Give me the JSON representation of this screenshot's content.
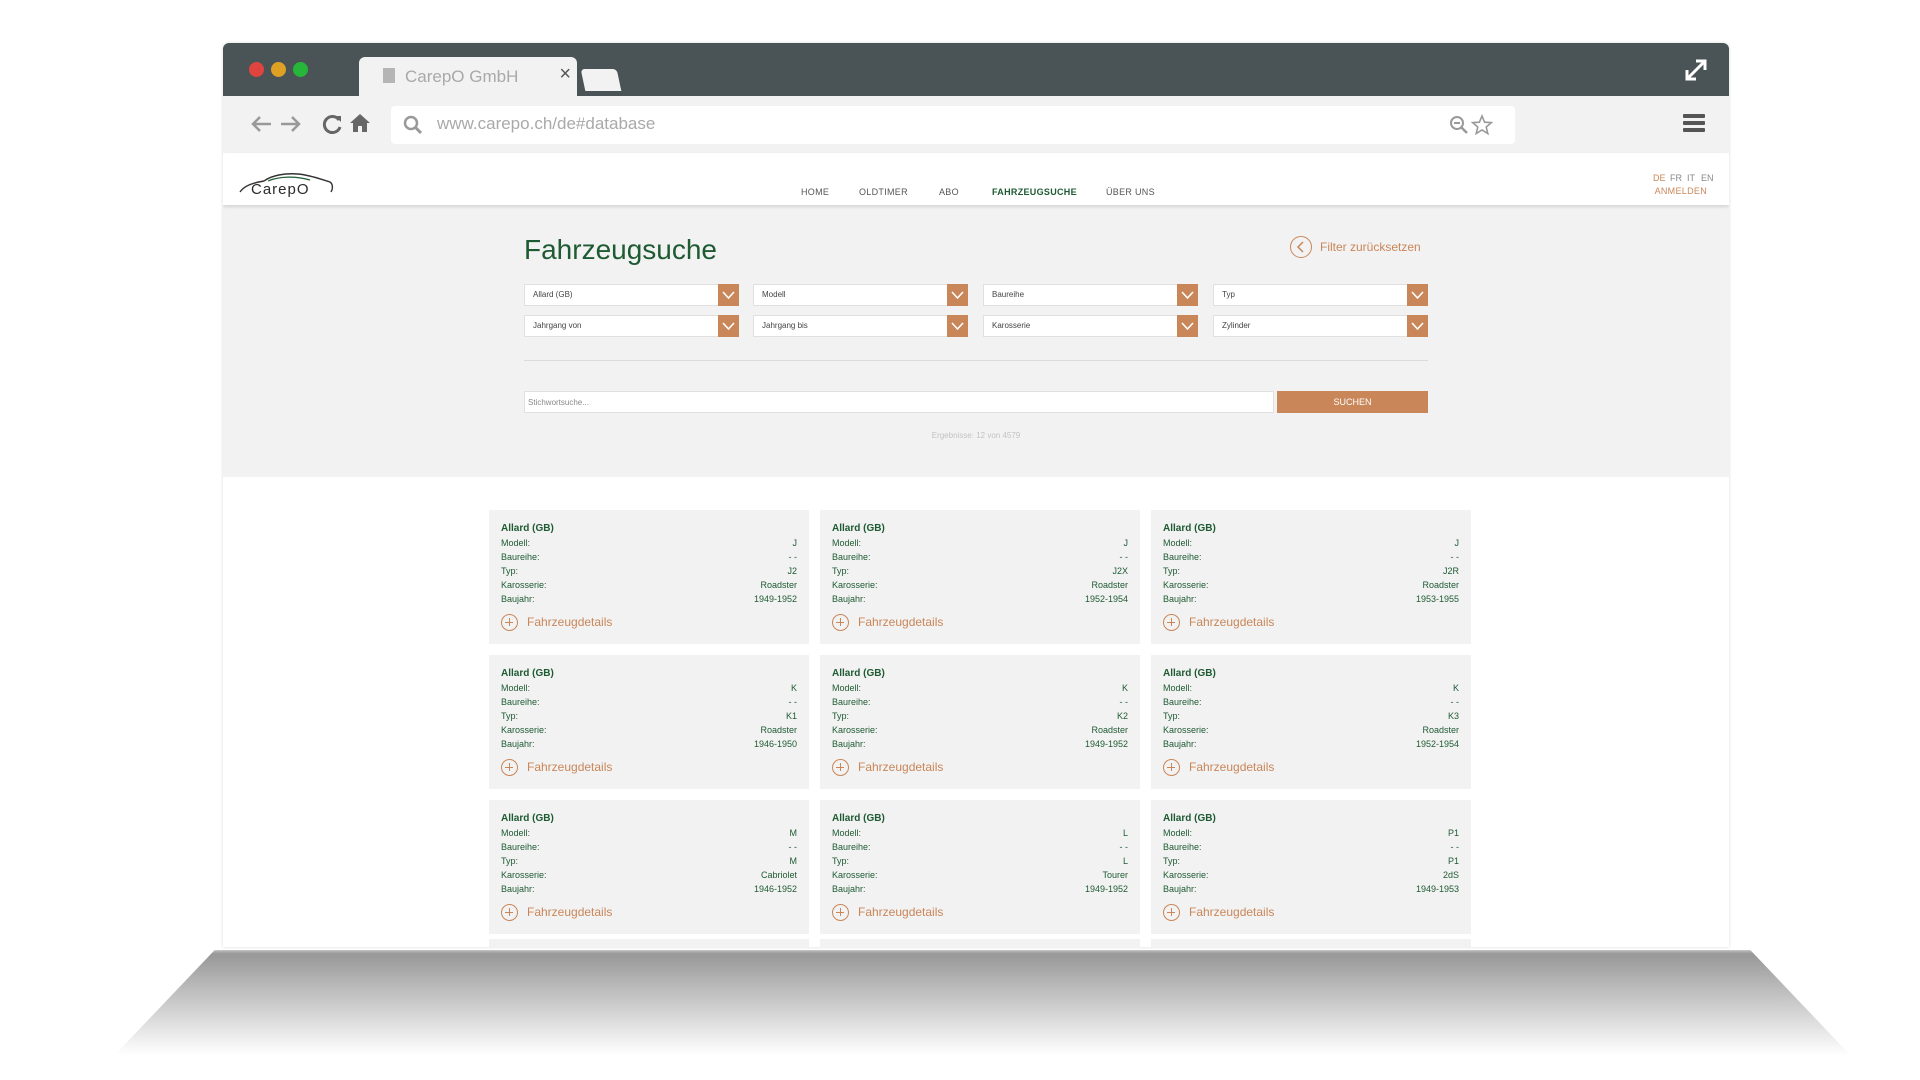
{
  "browser": {
    "tab_title": "CarepO GmbH",
    "tab_close": "×",
    "url": "www.carepo.ch/de#database",
    "icons": [
      "back-arrow-icon",
      "forward-arrow-icon",
      "reload-icon",
      "home-icon",
      "search-icon",
      "zoom-icon",
      "star-icon",
      "menu-icon",
      "expand-icon"
    ]
  },
  "site": {
    "logo_text": "CarepO",
    "nav": [
      "HOME",
      "OLDTIMER",
      "ABO",
      "FAHRZEUGSUCHE",
      "ÜBER UNS"
    ],
    "active_nav": "FAHRZEUGSUCHE",
    "languages": [
      "DE",
      "FR",
      "IT",
      "EN"
    ],
    "active_language": "DE",
    "login": "ANMELDEN"
  },
  "search": {
    "title": "Fahrzeugsuche",
    "reset_label": "Filter zurücksetzen",
    "filters_row1": [
      "Allard (GB)",
      "Modell",
      "Baureihe",
      "Typ"
    ],
    "filters_row2": [
      "Jahrgang von",
      "Jahrgang bis",
      "Karosserie",
      "Zylinder"
    ],
    "keyword_placeholder": "Stichwortsuche...",
    "search_button": "SUCHEN",
    "results_text": "Ergebnisse: 12 von 4579"
  },
  "labels": {
    "modell": "Modell:",
    "baureihe": "Baureihe:",
    "typ": "Typ:",
    "karosserie": "Karosserie:",
    "baujahr": "Baujahr:",
    "details": "Fahrzeugdetails"
  },
  "cards": [
    {
      "brand": "Allard (GB)",
      "modell": "J",
      "baureihe": "- -",
      "typ": "J2",
      "karosserie": "Roadster",
      "baujahr": "1949-1952"
    },
    {
      "brand": "Allard (GB)",
      "modell": "J",
      "baureihe": "- -",
      "typ": "J2X",
      "karosserie": "Roadster",
      "baujahr": "1952-1954"
    },
    {
      "brand": "Allard (GB)",
      "modell": "J",
      "baureihe": "- -",
      "typ": "J2R",
      "karosserie": "Roadster",
      "baujahr": "1953-1955"
    },
    {
      "brand": "Allard (GB)",
      "modell": "K",
      "baureihe": "- -",
      "typ": "K1",
      "karosserie": "Roadster",
      "baujahr": "1946-1950"
    },
    {
      "brand": "Allard (GB)",
      "modell": "K",
      "baureihe": "- -",
      "typ": "K2",
      "karosserie": "Roadster",
      "baujahr": "1949-1952"
    },
    {
      "brand": "Allard (GB)",
      "modell": "K",
      "baureihe": "- -",
      "typ": "K3",
      "karosserie": "Roadster",
      "baujahr": "1952-1954"
    },
    {
      "brand": "Allard (GB)",
      "modell": "M",
      "baureihe": "- -",
      "typ": "M",
      "karosserie": "Cabriolet",
      "baujahr": "1946-1952"
    },
    {
      "brand": "Allard (GB)",
      "modell": "L",
      "baureihe": "- -",
      "typ": "L",
      "karosserie": "Tourer",
      "baujahr": "1949-1952"
    },
    {
      "brand": "Allard (GB)",
      "modell": "P1",
      "baureihe": "- -",
      "typ": "P1",
      "karosserie": "2dS",
      "baujahr": "1949-1953"
    }
  ]
}
